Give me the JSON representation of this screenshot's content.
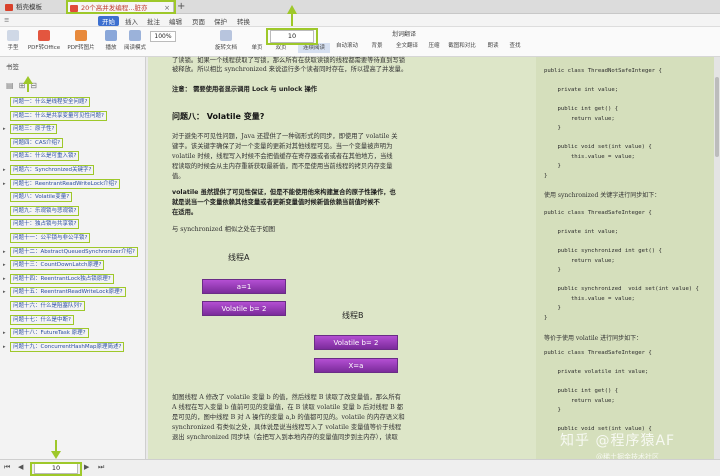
{
  "tabs": [
    {
      "label": "稻壳模板",
      "active": false
    },
    {
      "label": "20个高并发编程...脏亦脱？.pdf",
      "active": true
    }
  ],
  "menu": [
    "开始",
    "插入",
    "批注",
    "编辑",
    "页面",
    "保护",
    "转换"
  ],
  "toolbar": {
    "left": [
      "手型",
      "PDF转Office",
      "PDF转图片",
      "播放",
      "阅读模式"
    ],
    "zoom": "100%",
    "mid": [
      "旋转文档",
      "单页",
      "双页",
      "连续阅读"
    ],
    "right": [
      "自动滚动",
      "背景",
      "全文翻译",
      "压缩",
      "截图和对比",
      "朗读",
      "查找"
    ],
    "translate": "划词翻译",
    "page_value": "10"
  },
  "sidebar": {
    "title": "书签",
    "bookmarks": [
      "问题一：什么是线程安全问题?",
      "问题二：什么是共享变量可见性问题?",
      "问题三：原子性?",
      "问题四：CAS介绍?",
      "问题五：什么是可重入锁?",
      "问题六：Synchronized关键字?",
      "问题七：ReentrantReadWriteLock介绍?",
      "问题八：Volatile变量?",
      "问题九：乐观锁与悲观锁?",
      "问题十：独占锁与共享锁?",
      "问题十一：公平锁与非公平锁?",
      "问题十二：AbstractQueuedSynchronizer介绍?",
      "问题十三：CountDownLatch原理?",
      "问题十四：ReentrantLock独占锁原理?",
      "问题十五：ReentrantReadWriteLock原理?",
      "问题十六：什么是阻塞队列?",
      "问题十七：什么是中断?",
      "问题十八：FutureTask 原理?",
      "问题十九：ConcurrentHashMap原理简述?"
    ]
  },
  "content": {
    "top_lines": [
      "了读锁。如果一个线程获取了写锁，那么所有在获取读锁的线程都需要等待直到写锁",
      "被释放。所以相比 synchronized 来说运行多个读者同时存在，所以提高了并发量。"
    ],
    "note": "注意：  需要使用者显示调用 Lock 与 unlock 操作",
    "heading": "问题八：  Volatile 变量?",
    "para1": [
      "对于避免不可见性问题，Java 还提供了一种弱形式的同步，即使用了 volatile 关",
      "键字。该关键字确保了对一个变量的更新对其他线程可见。当一个变量被声明为",
      "volatile 时候，线程写入时候不会把值缓存在寄存器或者或者在其他地方，当线",
      "程读取的时候会从主内存重新获取最新值，而不是使用当前线程的拷贝内存变量",
      "值。"
    ],
    "bold_para": [
      "volatile 虽然提供了可见性保证，但是不能使用他来构建复合的原子性操作，也",
      "就是说当一个变量依赖其他变量或者更新变量值时候新值依赖当前值时候不",
      "在适用。"
    ],
    "compare": "与 synchronized 相似之处在于如图",
    "threadA": "线程A",
    "threadB": "线程B",
    "bars": [
      "a=1",
      "Volatile b= 2",
      "Volatile b= 2",
      "X=a"
    ],
    "bottom": [
      "如图线程 A 修改了 volatile 变量 b 的值，然后线程 B 读取了改变量值，那么所有",
      "A 线程在写入变量 b 值前可见的变量值，在 B 读取 volatile 变量 b 后对线程 B 都",
      "是可见的，图中线程 B 对 A 操作的变量 a,b 的值都可见的。volatile 的内存语义和",
      "synchronized 有类似之处，具体说是说当线程写入了 volatile 变量值等价于线程",
      "退出 synchronized 同步块（会把写入到本地内存的变量值同步到主内存），读取"
    ]
  },
  "right_page": {
    "code1": "public class ThreadNotSafeInteger {\n\n    private int value;\n\n    public int get() {\n        return value;\n    }\n\n    public void set(int value) {\n        this.value = value;\n    }\n}",
    "text1": "使用 synchronized 关键字进行同步如下：",
    "code2": "public class ThreadSafeInteger {\n\n    private int value;\n\n    public synchronized int get() {\n        return value;\n    }\n\n    public synchronized  void set(int value) {\n        this.value = value;\n    }\n}",
    "text2": "等价于使用 volatile 进行同步如下：",
    "code3": "public class ThreadSafeInteger {\n\n    private volatile int value;\n\n    public int get() {\n        return value;\n    }\n\n    public void set(int value) {"
  },
  "watermark": "知乎 @程序猿AF",
  "watermark_sub": "@稀土掘金技术社区",
  "status": {
    "page": "10"
  }
}
